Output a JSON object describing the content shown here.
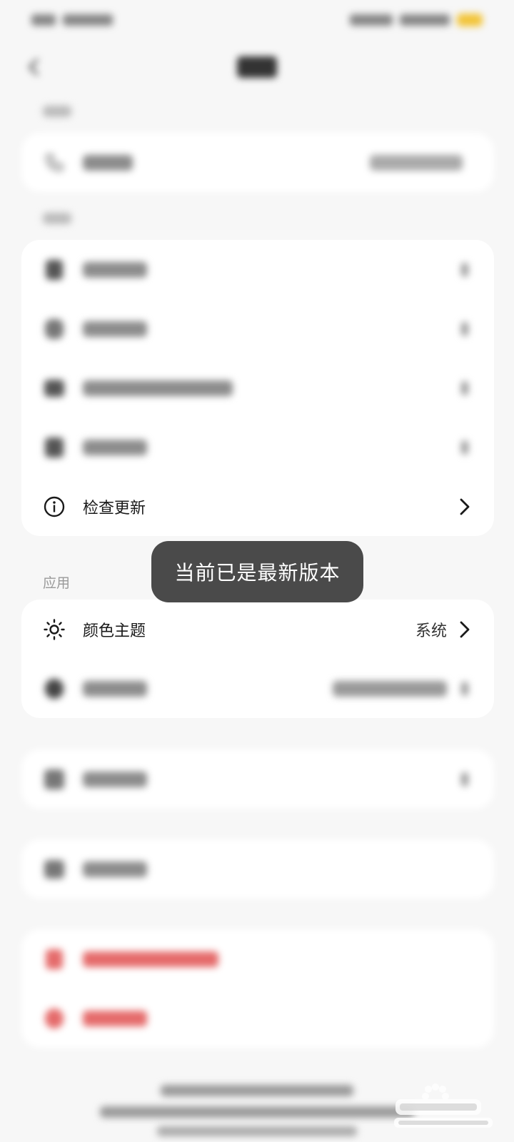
{
  "sections": {
    "app_label": "应用"
  },
  "rows": {
    "check_update": {
      "label": "检查更新"
    },
    "color_theme": {
      "label": "颜色主题",
      "value": "系统"
    }
  },
  "toast": {
    "message": "当前已是最新版本"
  },
  "icons": {
    "back": "back-arrow-icon",
    "info": "info-icon",
    "theme": "sun-icon",
    "chevron": "chevron-right-icon"
  },
  "colors": {
    "background": "#f7f7f7",
    "card": "#ffffff",
    "toast": "#4a4a4a",
    "battery": "#f2c438",
    "danger": "#e56b6b"
  }
}
